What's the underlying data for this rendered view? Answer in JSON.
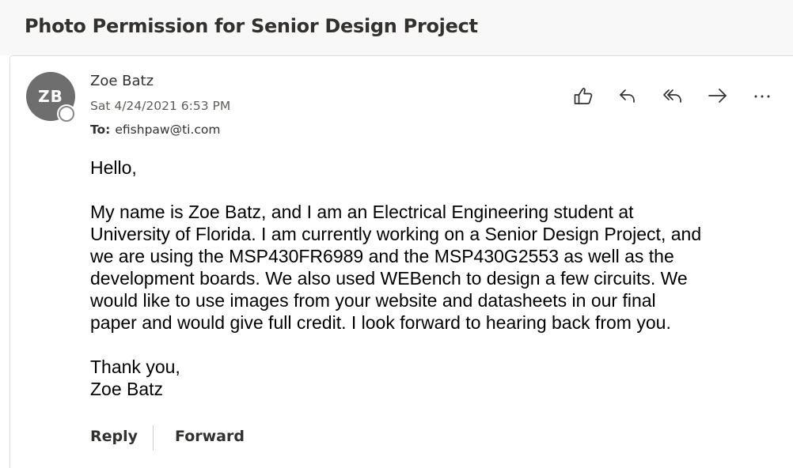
{
  "email": {
    "subject": "Photo Permission for Senior Design Project",
    "sender": {
      "initials": "ZB",
      "name": "Zoe Batz"
    },
    "date": "Sat 4/24/2021 6:53 PM",
    "to_label": "To:",
    "to_address": "efishpaw@ti.com",
    "body": {
      "greeting": "Hello,",
      "paragraph_lines": [
        "My name is Zoe Batz, and I am an Electrical Engineering student at",
        "University of Florida. I am currently working on a Senior Design Project, and",
        "we are using the MSP430FR6989 and the MSP430G2553 as well as the",
        "development boards. We also used WEBench to design a few circuits. We",
        "would like to use images from your website and datasheets in our final",
        "paper and would give full credit. I look forward to hearing back from you."
      ],
      "closing": "Thank you,",
      "signature": "Zoe Batz"
    }
  },
  "toolbar": {
    "icons": [
      "like-icon",
      "reply-icon",
      "reply-all-icon",
      "forward-icon",
      "more-icon"
    ]
  },
  "footer": {
    "reply_label": "Reply",
    "forward_label": "Forward"
  },
  "colors": {
    "subject_bar": "#f8f8f8",
    "avatar": "#6e6e6e",
    "text_primary": "#323130",
    "text_secondary": "#605e5c"
  }
}
